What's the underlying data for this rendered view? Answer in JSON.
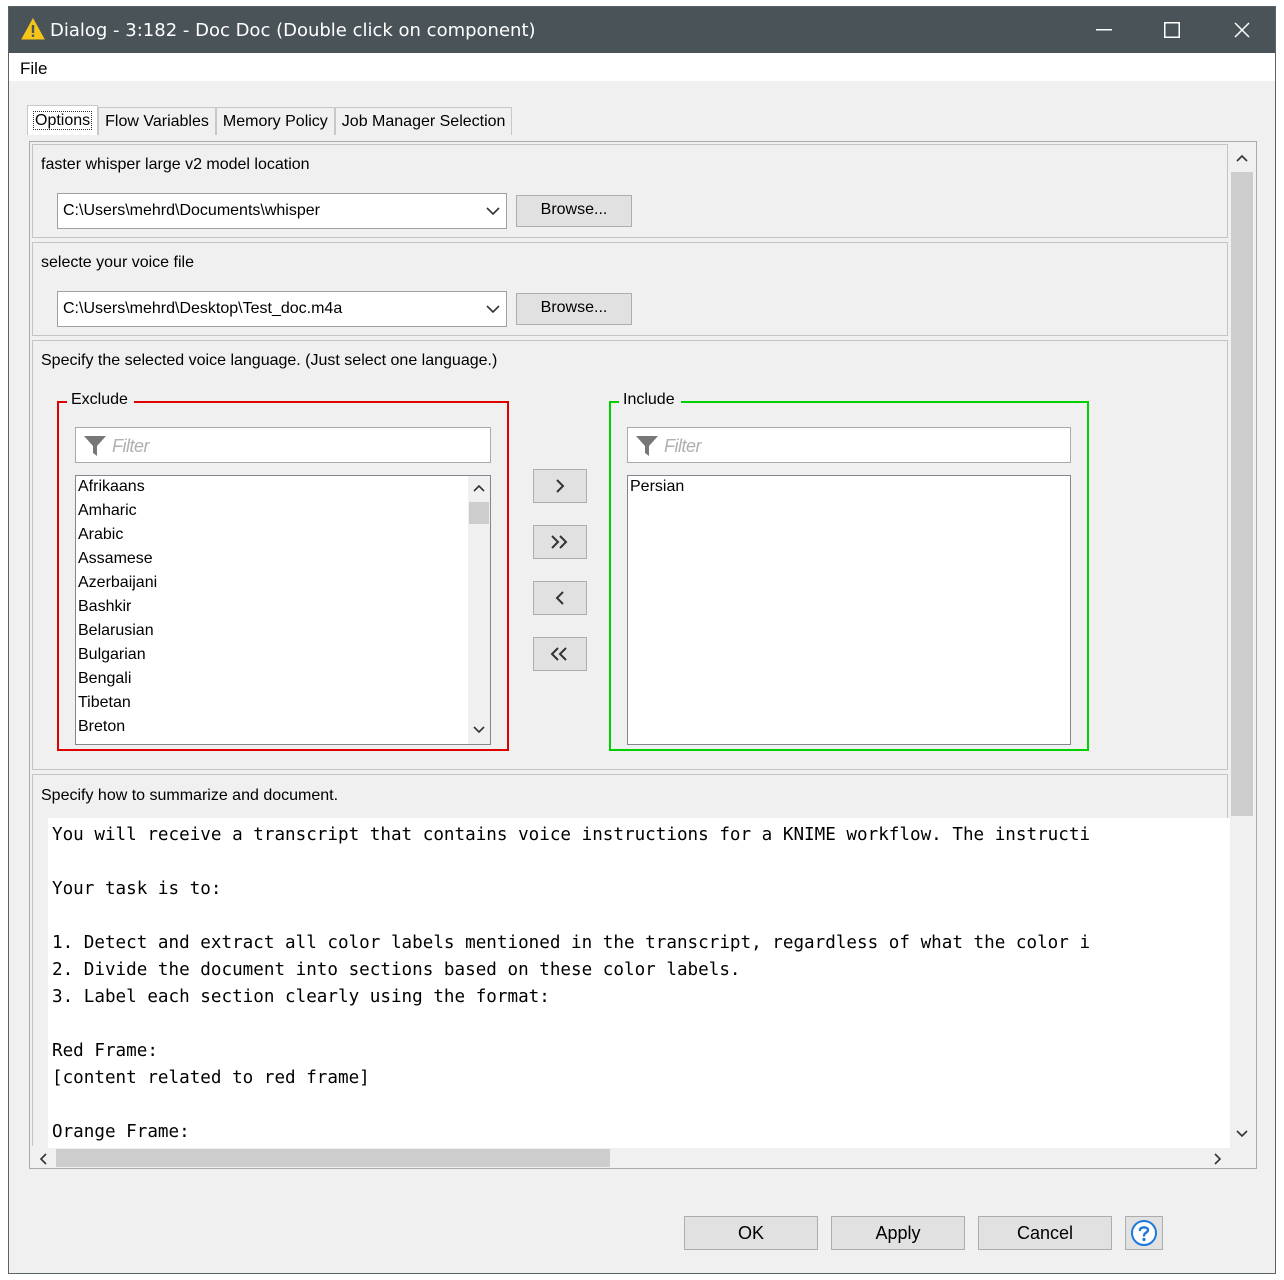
{
  "window": {
    "title": "Dialog - 3:182 - Doc Doc (Double click on component)"
  },
  "menu": {
    "file_label": "File"
  },
  "tabs": [
    {
      "label": "Options",
      "active": true
    },
    {
      "label": "Flow Variables",
      "active": false
    },
    {
      "label": "Memory Policy",
      "active": false
    },
    {
      "label": "Job Manager Selection",
      "active": false
    }
  ],
  "model_section": {
    "label": "faster whisper large v2 model location",
    "path_value": "C:\\Users\\mehrd\\Documents\\whisper",
    "browse_label": "Browse..."
  },
  "voice_section": {
    "label": "selecte your voice file",
    "path_value": "C:\\Users\\mehrd\\Desktop\\Test_doc.m4a",
    "browse_label": "Browse..."
  },
  "language_section": {
    "label": "Specify the selected voice language. (Just select one language.)",
    "exclude": {
      "legend": "Exclude",
      "filter_placeholder": "Filter",
      "items": [
        "Afrikaans",
        "Amharic",
        "Arabic",
        "Assamese",
        "Azerbaijani",
        "Bashkir",
        "Belarusian",
        "Bulgarian",
        "Bengali",
        "Tibetan",
        "Breton"
      ]
    },
    "include": {
      "legend": "Include",
      "filter_placeholder": "Filter",
      "items": [
        "Persian"
      ]
    }
  },
  "summary_section": {
    "label": "Specify how to summarize and document.",
    "text": "You will receive a transcript that contains voice instructions for a KNIME workflow. The instructi\n\nYour task is to:\n\n1. Detect and extract all color labels mentioned in the transcript, regardless of what the color i\n2. Divide the document into sections based on these color labels.\n3. Label each section clearly using the format:\n\nRed Frame:\n[content related to red frame]\n\nOrange Frame:"
  },
  "footer": {
    "ok_label": "OK",
    "apply_label": "Apply",
    "cancel_label": "Cancel"
  },
  "colors": {
    "titlebar": "#4a5357",
    "exclude_border": "#e00000",
    "include_border": "#00d000",
    "help_icon": "#1e78d7"
  }
}
